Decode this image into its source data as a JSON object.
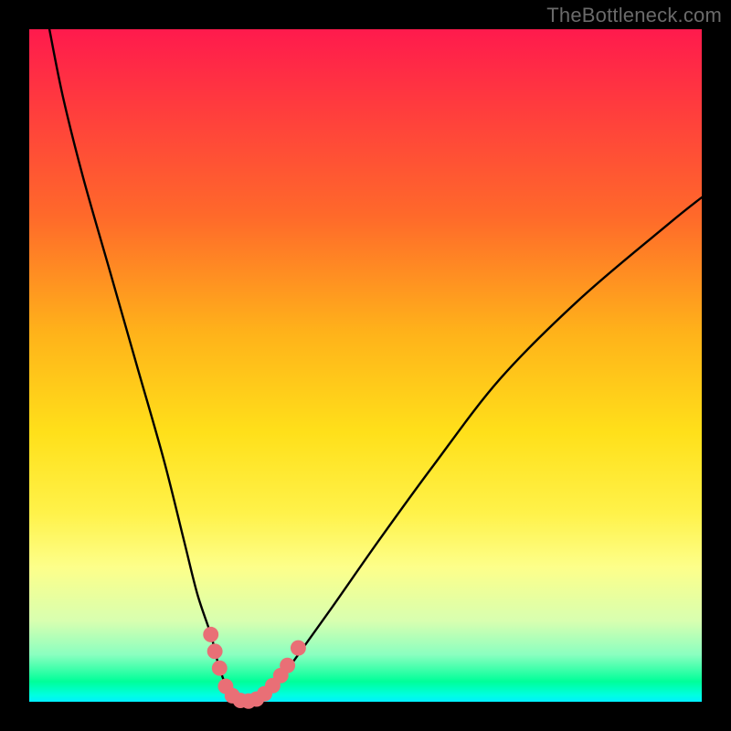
{
  "watermark": "TheBottleneck.com",
  "chart_data": {
    "type": "line",
    "title": "",
    "xlabel": "",
    "ylabel": "",
    "xlim": [
      0,
      100
    ],
    "ylim": [
      0,
      100
    ],
    "series": [
      {
        "name": "bottleneck-curve",
        "x": [
          3,
          5,
          8,
          12,
          16,
          20,
          23,
          25,
          27,
          28,
          29,
          30,
          31,
          33,
          35,
          37,
          40,
          45,
          52,
          60,
          70,
          82,
          95,
          100
        ],
        "values": [
          100,
          90,
          78,
          64,
          50,
          36,
          24,
          16,
          10,
          6,
          3,
          1,
          0,
          0,
          1,
          3,
          7,
          14,
          24,
          35,
          48,
          60,
          71,
          75
        ]
      }
    ],
    "markers": [
      {
        "name": "marker-left-1",
        "x": 27.0,
        "y": 10.0
      },
      {
        "name": "marker-left-2",
        "x": 27.6,
        "y": 7.5
      },
      {
        "name": "marker-left-3",
        "x": 28.3,
        "y": 5.0
      },
      {
        "name": "marker-bottom-1",
        "x": 29.2,
        "y": 2.3
      },
      {
        "name": "marker-bottom-2",
        "x": 30.2,
        "y": 0.9
      },
      {
        "name": "marker-bottom-3",
        "x": 31.4,
        "y": 0.2
      },
      {
        "name": "marker-bottom-4",
        "x": 32.6,
        "y": 0.1
      },
      {
        "name": "marker-bottom-5",
        "x": 33.8,
        "y": 0.4
      },
      {
        "name": "marker-bottom-6",
        "x": 35.0,
        "y": 1.2
      },
      {
        "name": "marker-bottom-7",
        "x": 36.2,
        "y": 2.4
      },
      {
        "name": "marker-bottom-8",
        "x": 37.4,
        "y": 3.9
      },
      {
        "name": "marker-right-1",
        "x": 38.4,
        "y": 5.4
      },
      {
        "name": "marker-right-2",
        "x": 40.0,
        "y": 8.0
      }
    ],
    "marker_style": {
      "color": "#e96f76",
      "radius_pct": 1.15
    }
  }
}
